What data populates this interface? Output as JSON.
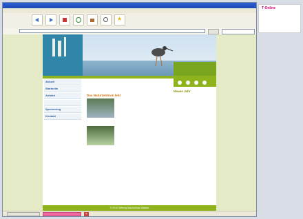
{
  "window": {
    "title": ""
  },
  "menubar": {
    "items": [
      "",
      "",
      "",
      "",
      "",
      "",
      "",
      "",
      ""
    ]
  },
  "toolbar": {
    "labels": [
      "",
      "",
      "",
      "",
      "",
      "",
      ""
    ]
  },
  "address": {
    "url": "",
    "search_placeholder": ""
  },
  "page": {
    "logo_text": "",
    "nav": {
      "items": [
        "Aktuell",
        "Startseite",
        "Anfahrt",
        "",
        "Sponsoring",
        "Kontakt"
      ]
    },
    "side_tabs": [],
    "content": {
      "welcome_title": "",
      "welcome_text": "",
      "section_1_title": "",
      "section_1_text": "",
      "section_2_title": "Das Naturzentrum lebt",
      "section_2_text": "",
      "section_3_title": "",
      "section_3_text": ""
    },
    "right_col": {
      "title_1": "Neues Jahr",
      "text_1": "",
      "title_2": "",
      "text_2": ""
    },
    "footer": "© 2010 Stiftung Naturschutz Wasser"
  },
  "statusbar": {
    "task_1": "",
    "task_2": "",
    "close": "×"
  },
  "right_pane": {
    "title": "T-Online",
    "subtitle": "",
    "small": ""
  },
  "colors": {
    "brand_green": "#8eb31d",
    "brand_blue": "#2f86a8",
    "accent_pink": "#d4006b"
  },
  "icons": {
    "back": "back-icon",
    "forward": "forward-icon",
    "stop": "stop-icon",
    "refresh": "refresh-icon",
    "home": "home-icon",
    "search": "search-icon",
    "favorites": "favorites-icon"
  }
}
